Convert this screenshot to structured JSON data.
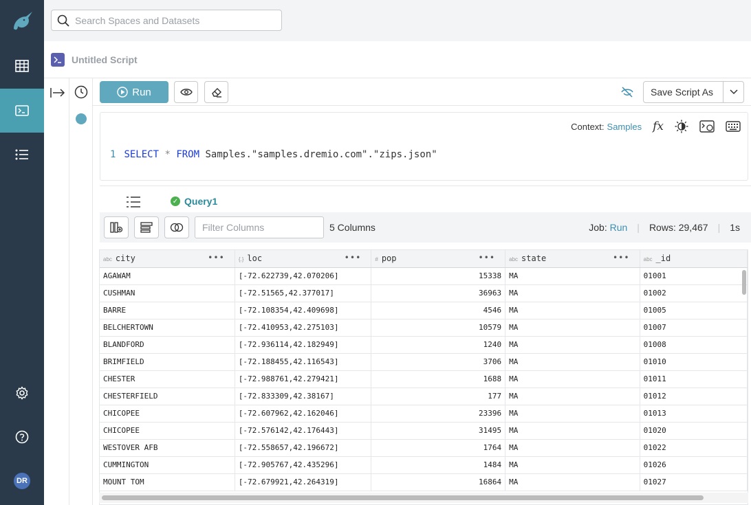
{
  "search": {
    "placeholder": "Search Spaces and Datasets"
  },
  "script": {
    "title": "Untitled Script"
  },
  "toolbar": {
    "run_label": "Run",
    "save_label": "Save Script As"
  },
  "editor": {
    "context_label": "Context:",
    "context_value": "Samples",
    "line_number": "1",
    "kw_select": "SELECT",
    "star": "*",
    "kw_from": "FROM",
    "query_rest": "Samples.\"samples.dremio.com\".\"zips.json\""
  },
  "results": {
    "tab_label": "Query1",
    "filter_placeholder": "Filter Columns",
    "column_count": "5 Columns",
    "job_label": "Job:",
    "job_value": "Run",
    "rows_label": "Rows:",
    "rows_value": "29,467",
    "duration": "1s"
  },
  "user": {
    "initials": "DR"
  },
  "table": {
    "columns": [
      {
        "type": "abc",
        "name": "city"
      },
      {
        "type": "{.}",
        "name": "loc"
      },
      {
        "type": "#",
        "name": "pop"
      },
      {
        "type": "abc",
        "name": "state"
      },
      {
        "type": "abc",
        "name": "_id"
      }
    ],
    "rows": [
      [
        "AGAWAM",
        "[-72.622739,42.070206]",
        "15338",
        "MA",
        "01001"
      ],
      [
        "CUSHMAN",
        "[-72.51565,42.377017]",
        "36963",
        "MA",
        "01002"
      ],
      [
        "BARRE",
        "[-72.108354,42.409698]",
        "4546",
        "MA",
        "01005"
      ],
      [
        "BELCHERTOWN",
        "[-72.410953,42.275103]",
        "10579",
        "MA",
        "01007"
      ],
      [
        "BLANDFORD",
        "[-72.936114,42.182949]",
        "1240",
        "MA",
        "01008"
      ],
      [
        "BRIMFIELD",
        "[-72.188455,42.116543]",
        "3706",
        "MA",
        "01010"
      ],
      [
        "CHESTER",
        "[-72.988761,42.279421]",
        "1688",
        "MA",
        "01011"
      ],
      [
        "CHESTERFIELD",
        "[-72.833309,42.38167]",
        "177",
        "MA",
        "01012"
      ],
      [
        "CHICOPEE",
        "[-72.607962,42.162046]",
        "23396",
        "MA",
        "01013"
      ],
      [
        "CHICOPEE",
        "[-72.576142,42.176443]",
        "31495",
        "MA",
        "01020"
      ],
      [
        "WESTOVER AFB",
        "[-72.558657,42.196672]",
        "1764",
        "MA",
        "01022"
      ],
      [
        "CUMMINGTON",
        "[-72.905767,42.435296]",
        "1484",
        "MA",
        "01026"
      ],
      [
        "MOUNT TOM",
        "[-72.679921,42.264319]",
        "16864",
        "MA",
        "01027"
      ]
    ]
  },
  "colors": {
    "sidebar": "#2a3a4a",
    "accent": "#5fa8bd",
    "link": "#3c8eb0"
  }
}
